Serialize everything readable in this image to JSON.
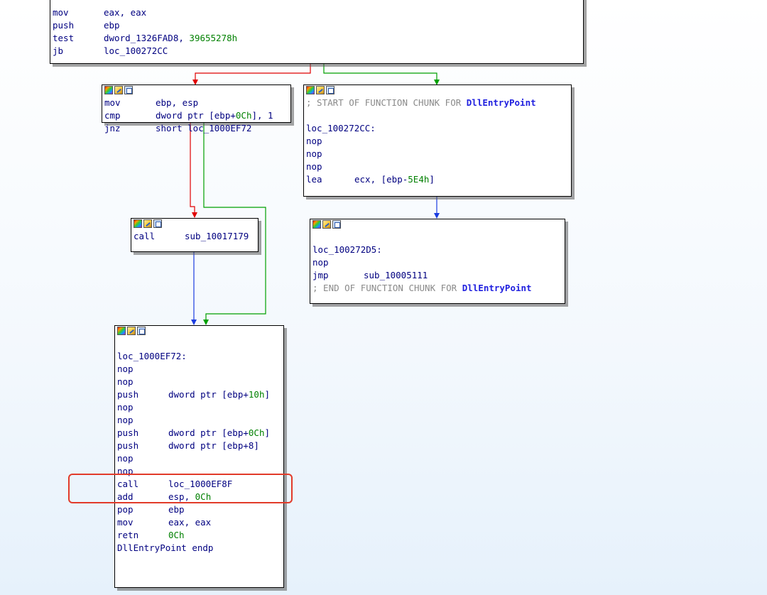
{
  "nodes": {
    "top": {
      "lines": [
        {
          "mn": "mov",
          "op": "eax, eax"
        },
        {
          "mn": "push",
          "op": "ebp"
        },
        {
          "mn": "test",
          "op": "dword_1326FAD8, ",
          "num": "39655278h"
        },
        {
          "mn": "jb",
          "op": "loc_100272CC"
        }
      ]
    },
    "left1": {
      "lines": [
        {
          "mn": "mov",
          "op": "ebp, esp"
        },
        {
          "mn": "cmp",
          "op": "dword ptr [ebp+",
          "num": "0Ch",
          "op2": "], 1"
        },
        {
          "mn": "jnz",
          "op": "short loc_1000EF72"
        }
      ]
    },
    "chunk1": {
      "comment_prefix": "; START OF FUNCTION CHUNK FOR ",
      "func": "DllEntryPoint",
      "label": "loc_100272CC:",
      "lines": [
        {
          "mn": "nop",
          "op": ""
        },
        {
          "mn": "nop",
          "op": ""
        },
        {
          "mn": "nop",
          "op": ""
        },
        {
          "mn": "lea",
          "op": "ecx, [ebp-",
          "num": "5E4h",
          "op2": "]"
        }
      ]
    },
    "call_node": {
      "lines": [
        {
          "mn": "call",
          "op": "sub_10017179"
        }
      ]
    },
    "chunk2": {
      "label": "loc_100272D5:",
      "lines": [
        {
          "mn": "nop",
          "op": ""
        },
        {
          "mn": "jmp",
          "op": "sub_10005111"
        }
      ],
      "comment_prefix": "; END OF FUNCTION CHUNK FOR ",
      "func": "DllEntryPoint"
    },
    "main": {
      "label": "loc_1000EF72:",
      "lines": [
        {
          "mn": "nop",
          "op": ""
        },
        {
          "mn": "nop",
          "op": ""
        },
        {
          "mn": "push",
          "op": "dword ptr [ebp+",
          "num": "10h",
          "op2": "]"
        },
        {
          "mn": "nop",
          "op": ""
        },
        {
          "mn": "nop",
          "op": ""
        },
        {
          "mn": "push",
          "op": "dword ptr [ebp+",
          "num": "0Ch",
          "op2": "]"
        },
        {
          "mn": "push",
          "op": "dword ptr [ebp+8]"
        },
        {
          "mn": "nop",
          "op": ""
        },
        {
          "mn": "nop",
          "op": ""
        },
        {
          "mn": "call",
          "op": "loc_1000EF8F"
        },
        {
          "mn": "add",
          "op": "esp, ",
          "num": "0Ch"
        },
        {
          "mn": "pop",
          "op": "ebp"
        },
        {
          "mn": "mov",
          "op": "eax, eax"
        },
        {
          "mn": "retn",
          "op": "",
          "num": "0Ch"
        }
      ],
      "footer": "DllEntryPoint endp"
    }
  },
  "colors": {
    "edge_true": "#00a000",
    "edge_false": "#e00000",
    "edge_uncond": "#1a3ce0",
    "highlight": "#e23b2a"
  }
}
